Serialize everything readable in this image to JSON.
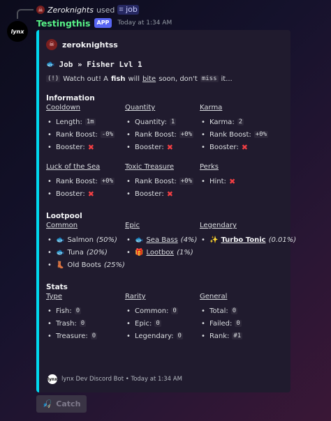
{
  "reply": {
    "username": "Zeroknights",
    "used_text": "used",
    "command": "job"
  },
  "message": {
    "bot_name": "Testingthis",
    "badge": "APP",
    "timestamp": "Today at 1:34 AM",
    "avatar_text": "lynx"
  },
  "embed": {
    "author": "zeroknightss",
    "title": "Job » Fisher Lvl 1",
    "desc": {
      "prefix": "(!)",
      "t1": "Watch out! A",
      "fish": "fish",
      "t2": "will",
      "bite": "bite",
      "t3": "soon, don't",
      "miss": "miss",
      "t4": "it..."
    },
    "information": {
      "title": "Information",
      "cooldown": {
        "head": "Cooldown",
        "length_label": "Length:",
        "length_value": "1m",
        "rank_label": "Rank Boost:",
        "rank_value": "-0%",
        "booster_label": "Booster:"
      },
      "quantity": {
        "head": "Quantity",
        "q_label": "Quantity:",
        "q_value": "1",
        "rank_label": "Rank Boost:",
        "rank_value": "+0%",
        "booster_label": "Booster:"
      },
      "karma": {
        "head": "Karma",
        "k_label": "Karma:",
        "k_value": "2",
        "rank_label": "Rank Boost:",
        "rank_value": "+0%",
        "booster_label": "Booster:"
      },
      "luck": {
        "head": "Luck of the Sea",
        "rank_label": "Rank Boost:",
        "rank_value": "+0%",
        "booster_label": "Booster:"
      },
      "toxic": {
        "head": "Toxic Treasure",
        "rank_label": "Rank Boost:",
        "rank_value": "+0%",
        "booster_label": "Booster:"
      },
      "perks": {
        "head": "Perks",
        "hint_label": "Hint:"
      }
    },
    "lootpool": {
      "title": "Lootpool",
      "common": {
        "head": "Common",
        "salmon": "Salmon",
        "salmon_pct": "(50%)",
        "tuna": "Tuna",
        "tuna_pct": "(20%)",
        "boots": "Old Boots",
        "boots_pct": "(25%)"
      },
      "epic": {
        "head": "Epic",
        "bass": "Sea Bass",
        "bass_pct": "(4%)",
        "lootbox": "Lootbox",
        "lootbox_pct": "(1%)"
      },
      "legendary": {
        "head": "Legendary",
        "tonic": "Turbo Tonic",
        "tonic_pct": "(0.01%)"
      }
    },
    "stats": {
      "title": "Stats",
      "type": {
        "head": "Type",
        "fish_label": "Fish:",
        "fish_value": "0",
        "trash_label": "Trash:",
        "trash_value": "0",
        "treasure_label": "Treasure:",
        "treasure_value": "0"
      },
      "rarity": {
        "head": "Rarity",
        "common_label": "Common:",
        "common_value": "0",
        "epic_label": "Epic:",
        "epic_value": "0",
        "legendary_label": "Legendary:",
        "legendary_value": "0"
      },
      "general": {
        "head": "General",
        "total_label": "Total:",
        "total_value": "0",
        "failed_label": "Failed:",
        "failed_value": "0",
        "rank_label": "Rank:",
        "rank_value": "#1"
      }
    },
    "footer": {
      "text": "lynx Dev Discord Bot • Today at 1:34 AM",
      "icon_text": "lynx"
    }
  },
  "button": {
    "catch_label": "Catch"
  },
  "colors": {
    "bot_name": "#57f287",
    "embed_border": "#00d9f0",
    "badge": "#5865f2",
    "cross": "#f23f43"
  }
}
